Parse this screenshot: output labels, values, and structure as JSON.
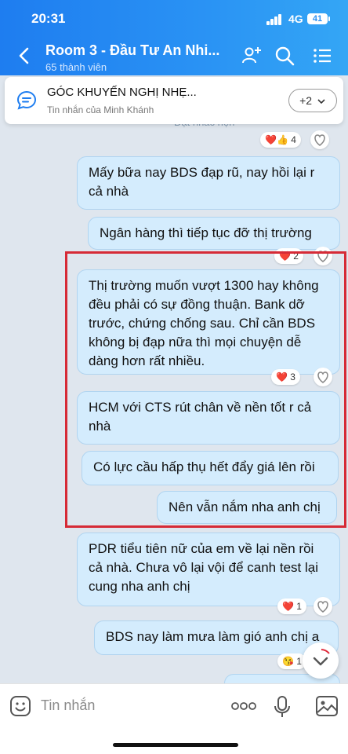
{
  "status_bar": {
    "time": "20:31",
    "network": "4G",
    "battery": "41"
  },
  "header": {
    "title": "Room 3 - Đầu Tư An Nhi...",
    "subtitle": "65 thành viên"
  },
  "pinned": {
    "title": "GÓC KHUYẾN NGHỊ NHẸ...",
    "sender": "Tin nhắn của Minh Khánh",
    "more_count": "+2"
  },
  "messages": [
    {
      "text": "Đặt nhắc hẹn",
      "reaction": "❤️👍",
      "reaction_count": "4"
    },
    {
      "text": "Mấy bữa nay BDS đạp rũ, nay hồi lại r cả nhà"
    },
    {
      "text": "Ngân hàng thì tiếp tục đỡ thị trường",
      "reaction": "❤️",
      "reaction_count": "2"
    },
    {
      "text": "Thị trường muốn vượt 1300 hay không đều phải có sự đồng thuận. Bank dỡ trước, chứng chống sau. Chỉ cần BDS không bị đạp nữa thì mọi chuyện dễ dàng hơn rất nhiều.",
      "reaction": "❤️",
      "reaction_count": "3"
    },
    {
      "text": "HCM với CTS rút chân về nền tốt r cả nhà"
    },
    {
      "text": "Có lực cầu hấp thụ hết đẩy giá lên rồi"
    },
    {
      "text": "Nên vẫn nắm nha anh chị"
    },
    {
      "text": "PDR tiểu tiên nữ của em về lại nền rồi cả nhà. Chưa vô lại vội để canh test lại cung nha anh chị",
      "reaction": "❤️",
      "reaction_count": "1"
    },
    {
      "text": "BDS nay làm mưa làm gió anh chị a",
      "reaction": "😘",
      "reaction_count": "1"
    }
  ],
  "composer": {
    "placeholder": "Tin nhắn"
  },
  "colors": {
    "header_start": "#1e7df0",
    "header_end": "#34a6f5",
    "bubble": "#d4ecfd",
    "highlight": "#d62a36"
  }
}
